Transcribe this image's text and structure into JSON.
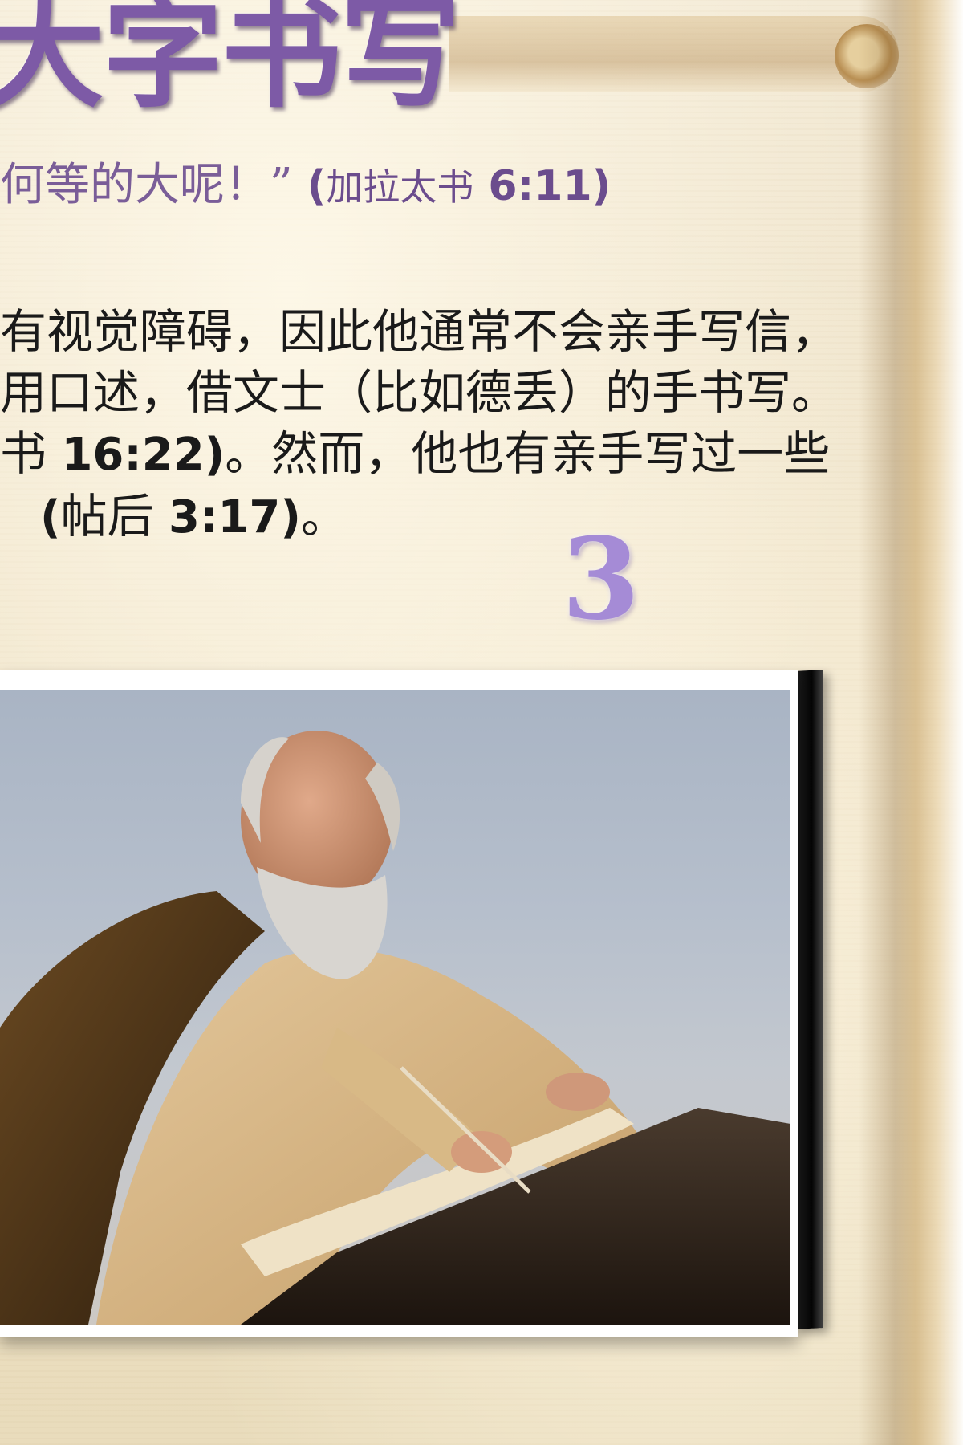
{
  "slide": {
    "title": "大字书写",
    "quote": {
      "text": "何等的大呢！”",
      "ref_open": "(",
      "ref_book": "加拉太书",
      "ref_verse": " 6:11)"
    },
    "body_lines": [
      {
        "segments": [
          {
            "text": "有视觉障碍，因此他通常不会亲手写信，",
            "bold": false
          }
        ]
      },
      {
        "segments": [
          {
            "text": "用口述，借文士（比如德丢）的手书写。",
            "bold": false
          }
        ]
      },
      {
        "segments": [
          {
            "text": "书 ",
            "bold": false
          },
          {
            "text": "16:22)",
            "bold": true
          },
          {
            "text": "。然而，他也有亲手写过一些",
            "bold": false
          }
        ]
      },
      {
        "segments": [
          {
            "text": "(",
            "bold": true
          },
          {
            "text": "帖后 ",
            "bold": false
          },
          {
            "text": "3:17)",
            "bold": true
          },
          {
            "text": "。",
            "bold": false
          }
        ]
      }
    ],
    "page_number": "3",
    "illustration": {
      "subject": "elderly bearded man writing with a pen on a scroll",
      "frame_style": "gallery canvas"
    }
  },
  "colors": {
    "title": "#7d5aa6",
    "quote": "#7a5d98",
    "body": "#1a1a1a",
    "page_number": "#a58bd6",
    "parchment": "#ede2c8"
  }
}
